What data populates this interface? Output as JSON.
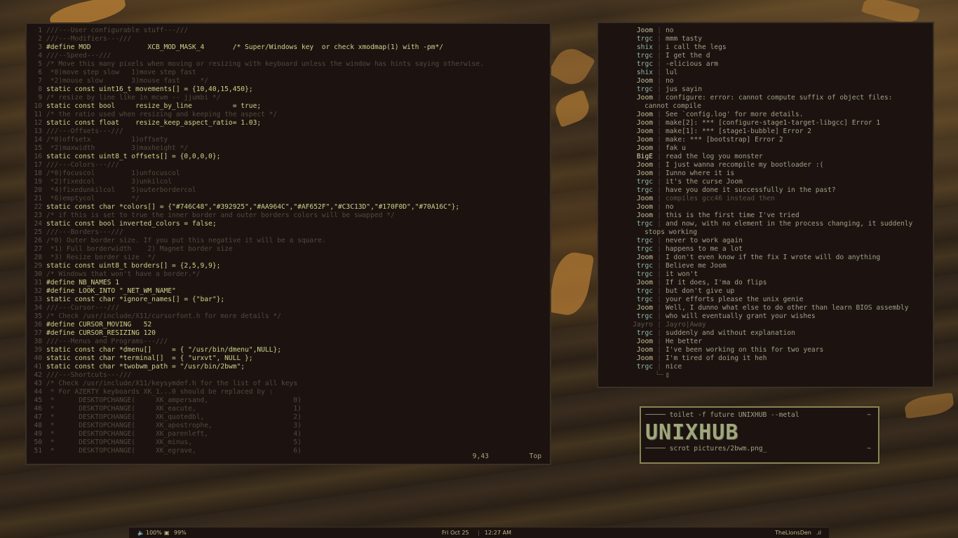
{
  "editor": {
    "ruler": "9,43",
    "position": "Top",
    "lines": [
      {
        "n": "1",
        "t": "///---User configurable stuff---///",
        "k": "comment"
      },
      {
        "n": "2",
        "t": "///---Modifiers---///",
        "k": "comment"
      },
      {
        "n": "3",
        "t": "#define MOD              XCB_MOD_MASK_4       /* Super/Windows key  or check xmodmap(1) with -pm*/",
        "k": "code"
      },
      {
        "n": "4",
        "t": "///--Speed---///",
        "k": "comment"
      },
      {
        "n": "5",
        "t": "/* Move this many pixels when moving or resizing with keyboard unless the window has hints saying otherwise.",
        "k": "comment"
      },
      {
        "n": "6",
        "t": " *0)move step slow   1)move step fast",
        "k": "comment"
      },
      {
        "n": "7",
        "t": " *2)mouse slow       3)mouse fast     */",
        "k": "comment"
      },
      {
        "n": "8",
        "t": "static const uint16_t movements[] = {10,40,15,450};",
        "k": "code"
      },
      {
        "n": "9",
        "t": "/* resize by line like in mcwm -- jjumbi */",
        "k": "comment"
      },
      {
        "n": "10",
        "t": "static const bool     resize_by_line          = true;",
        "k": "code"
      },
      {
        "n": "11",
        "t": "/* the ratio used when resizing and keeping the aspect */",
        "k": "comment"
      },
      {
        "n": "12",
        "t": "static const float    resize_keep_aspect_ratio= 1.03;",
        "k": "code"
      },
      {
        "n": "13",
        "t": "///---Offsets---///",
        "k": "comment"
      },
      {
        "n": "14",
        "t": "/*0)offsetx          1)offsety",
        "k": "comment"
      },
      {
        "n": "15",
        "t": " *2)maxwidth         3)maxheight */",
        "k": "comment"
      },
      {
        "n": "16",
        "t": "static const uint8_t offsets[] = {0,0,0,0};",
        "k": "code"
      },
      {
        "n": "17",
        "t": "///---Colors---///",
        "k": "comment"
      },
      {
        "n": "18",
        "t": "/*0)focuscol         1)unfocuscol",
        "k": "comment"
      },
      {
        "n": "19",
        "t": " *2)fixedcol         3)unkilcol",
        "k": "comment"
      },
      {
        "n": "20",
        "t": " *4)fixedunkilcol    5)outerbordercol",
        "k": "comment"
      },
      {
        "n": "21",
        "t": " *6)emptycol         */",
        "k": "comment"
      },
      {
        "n": "22",
        "t": "static const char *colors[] = {\"#746C48\",\"#392925\",\"#AA964C\",\"#AF652F\",\"#C3C13D\",\"#170F0D\",\"#70A16C\"};",
        "k": "code"
      },
      {
        "n": "23",
        "t": "/* if this is set to true the inner border and outer borders colors will be swapped */",
        "k": "comment"
      },
      {
        "n": "24",
        "t": "static const bool inverted_colors = false;",
        "k": "code"
      },
      {
        "n": "25",
        "t": "///---Borders---///",
        "k": "comment"
      },
      {
        "n": "26",
        "t": "/*0) Outer border size. If you put this negative it will be a square.",
        "k": "comment"
      },
      {
        "n": "27",
        "t": " *1) Full borderwidth    2) Magnet border size",
        "k": "comment"
      },
      {
        "n": "28",
        "t": " *3) Resize border size  */",
        "k": "comment"
      },
      {
        "n": "29",
        "t": "static const uint8_t borders[] = {2,5,9,9};",
        "k": "code"
      },
      {
        "n": "30",
        "t": "/* Windows that won't have a border.*/",
        "k": "comment"
      },
      {
        "n": "31",
        "t": "#define NB_NAMES 1",
        "k": "code"
      },
      {
        "n": "32",
        "t": "#define LOOK_INTO \"_NET_WM_NAME\"",
        "k": "code"
      },
      {
        "n": "33",
        "t": "static const char *ignore_names[] = {\"bar\"};",
        "k": "code"
      },
      {
        "n": "34",
        "t": "///---Cursor---///",
        "k": "comment"
      },
      {
        "n": "35",
        "t": "/* Check /usr/include/X11/cursorfont.h for more details */",
        "k": "comment"
      },
      {
        "n": "36",
        "t": "#define CURSOR_MOVING   52",
        "k": "code"
      },
      {
        "n": "37",
        "t": "#define CURSOR_RESIZING 120",
        "k": "code"
      },
      {
        "n": "38",
        "t": "///---Menus and Programs---///",
        "k": "comment"
      },
      {
        "n": "39",
        "t": "static const char *dmenu[]     = { \"/usr/bin/dmenu\",NULL};",
        "k": "code"
      },
      {
        "n": "40",
        "t": "static const char *terminal[]  = { \"urxvt\", NULL };",
        "k": "code"
      },
      {
        "n": "41",
        "t": "static const char *twobwm_path = \"/usr/bin/2bwm\";",
        "k": "code"
      },
      {
        "n": "42",
        "t": "///---Shortcuts---///",
        "k": "comment"
      },
      {
        "n": "43",
        "t": "/* Check /usr/include/X11/keysymdef.h for the list of all keys",
        "k": "comment"
      },
      {
        "n": "44",
        "t": " * For AZERTY keyboards XK_1...0 should be replaced by :",
        "k": "comment"
      },
      {
        "n": "45",
        "t": " *      DESKTOPCHANGE(     XK_ampersand,                     0)",
        "k": "comment"
      },
      {
        "n": "46",
        "t": " *      DESKTOPCHANGE(     XK_eacute,                        1)",
        "k": "comment"
      },
      {
        "n": "47",
        "t": " *      DESKTOPCHANGE(     XK_quotedbl,                      2)",
        "k": "comment"
      },
      {
        "n": "48",
        "t": " *      DESKTOPCHANGE(     XK_apostrophe,                    3)",
        "k": "comment"
      },
      {
        "n": "49",
        "t": " *      DESKTOPCHANGE(     XK_parenleft,                     4)",
        "k": "comment"
      },
      {
        "n": "50",
        "t": " *      DESKTOPCHANGE(     XK_minus,                         5)",
        "k": "comment"
      },
      {
        "n": "51",
        "t": " *      DESKTOPCHANGE(     XK_egrave,                        6)",
        "k": "comment"
      }
    ]
  },
  "irc": {
    "messages": [
      {
        "nick": "Joom",
        "text": "no"
      },
      {
        "nick": "trgc",
        "text": "mmm tasty"
      },
      {
        "nick": "shix",
        "text": "i call the legs"
      },
      {
        "nick": "trgc",
        "text": "I get the d"
      },
      {
        "nick": "trgc",
        "text": "-elicious arm"
      },
      {
        "nick": "shix",
        "text": "lul"
      },
      {
        "nick": "Joom",
        "text": "no"
      },
      {
        "nick": "trgc",
        "text": "jus sayin"
      },
      {
        "nick": "Joom",
        "text": "configure: error: cannot compute suffix of object files:"
      },
      {
        "nick": "",
        "text": "cannot compile",
        "cont": true
      },
      {
        "nick": "Joom",
        "text": "See `config.log' for more details."
      },
      {
        "nick": "Joom",
        "text": "make[2]: *** [configure-stage1-target-libgcc] Error 1"
      },
      {
        "nick": "Joom",
        "text": "make[1]: *** [stage1-bubble] Error 2"
      },
      {
        "nick": "Joom",
        "text": "make: *** [bootstrap] Error 2"
      },
      {
        "nick": "Joom",
        "text": "fak u"
      },
      {
        "nick": "BigE",
        "text": "read the log you monster"
      },
      {
        "nick": "Joom",
        "text": "I just wanna recompile my bootloader :("
      },
      {
        "nick": "Joom",
        "text": "Iunno where it is"
      },
      {
        "nick": "trgc",
        "text": "it's the curse Joom"
      },
      {
        "nick": "trgc",
        "text": "have you done it successfully in the past?"
      },
      {
        "nick": "Joom",
        "text": "compiles gcc46 instead then",
        "dim": true
      },
      {
        "nick": "Joom",
        "text": "no"
      },
      {
        "nick": "Joom",
        "text": "this is the first time I've tried"
      },
      {
        "nick": "trgc",
        "text": "and now, with no element in the process changing, it suddenly"
      },
      {
        "nick": "",
        "text": "stops working",
        "cont": true
      },
      {
        "nick": "trgc",
        "text": "never to work again"
      },
      {
        "nick": "trgc",
        "text": "happens to me a lot"
      },
      {
        "nick": "Joom",
        "text": "I don't even know if the fix I wrote will do anything"
      },
      {
        "nick": "trgc",
        "text": "Believe me Joom"
      },
      {
        "nick": "trgc",
        "text": "it won't"
      },
      {
        "nick": "Joom",
        "text": "If it does, I'ma do flips"
      },
      {
        "nick": "trgc",
        "text": "but don't give up"
      },
      {
        "nick": "trgc",
        "text": "your efforts please the unix genie"
      },
      {
        "nick": "Joom",
        "text": "Well, I dunno what else to do other than learn BIOS assembly"
      },
      {
        "nick": "trgc",
        "text": "who will eventually grant your wishes"
      },
      {
        "nick": "Jayro",
        "text": "Jayro|Away",
        "dim": true
      },
      {
        "nick": "trgc",
        "text": "suddenly and without explanation"
      },
      {
        "nick": "Joom",
        "text": "He better"
      },
      {
        "nick": "Joom",
        "text": "I've been working on this for two years"
      },
      {
        "nick": "Joom",
        "text": "I'm tired of doing it heh"
      },
      {
        "nick": "trgc",
        "text": "nice"
      }
    ]
  },
  "terminal": {
    "prompt_prefix": "───── ",
    "command1": "toilet -f future UNIXHUB --metal",
    "banner": "UNIXHUB",
    "command2": "scrot pictures/2bwm.png_",
    "tilde": "~"
  },
  "statusbar": {
    "volume_icon": "speaker-icon",
    "volume": "100%",
    "battery_icon": "battery-icon",
    "battery": "99%",
    "date": "Fri Oct 25",
    "time": "12:27 AM",
    "host": "TheLionsDen",
    "signal_icon": "signal-icon"
  },
  "colors": {
    "window_bg": "#1c1310",
    "code": "#cbd38a",
    "comment": "#4e4b3e",
    "active_border": "#8a8354"
  }
}
